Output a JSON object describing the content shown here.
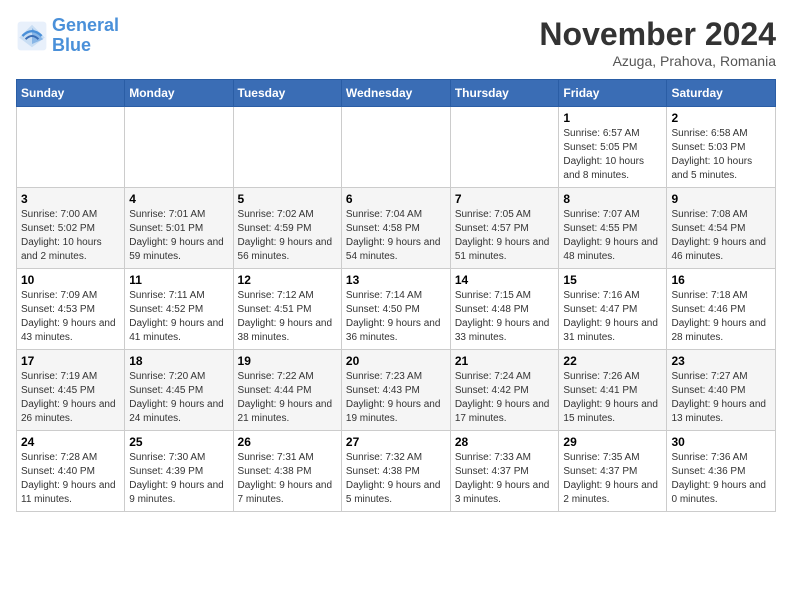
{
  "header": {
    "logo_line1": "General",
    "logo_line2": "Blue",
    "month": "November 2024",
    "location": "Azuga, Prahova, Romania"
  },
  "weekdays": [
    "Sunday",
    "Monday",
    "Tuesday",
    "Wednesday",
    "Thursday",
    "Friday",
    "Saturday"
  ],
  "weeks": [
    [
      {
        "day": "",
        "sunrise": "",
        "sunset": "",
        "daylight": ""
      },
      {
        "day": "",
        "sunrise": "",
        "sunset": "",
        "daylight": ""
      },
      {
        "day": "",
        "sunrise": "",
        "sunset": "",
        "daylight": ""
      },
      {
        "day": "",
        "sunrise": "",
        "sunset": "",
        "daylight": ""
      },
      {
        "day": "",
        "sunrise": "",
        "sunset": "",
        "daylight": ""
      },
      {
        "day": "1",
        "sunrise": "Sunrise: 6:57 AM",
        "sunset": "Sunset: 5:05 PM",
        "daylight": "Daylight: 10 hours and 8 minutes."
      },
      {
        "day": "2",
        "sunrise": "Sunrise: 6:58 AM",
        "sunset": "Sunset: 5:03 PM",
        "daylight": "Daylight: 10 hours and 5 minutes."
      }
    ],
    [
      {
        "day": "3",
        "sunrise": "Sunrise: 7:00 AM",
        "sunset": "Sunset: 5:02 PM",
        "daylight": "Daylight: 10 hours and 2 minutes."
      },
      {
        "day": "4",
        "sunrise": "Sunrise: 7:01 AM",
        "sunset": "Sunset: 5:01 PM",
        "daylight": "Daylight: 9 hours and 59 minutes."
      },
      {
        "day": "5",
        "sunrise": "Sunrise: 7:02 AM",
        "sunset": "Sunset: 4:59 PM",
        "daylight": "Daylight: 9 hours and 56 minutes."
      },
      {
        "day": "6",
        "sunrise": "Sunrise: 7:04 AM",
        "sunset": "Sunset: 4:58 PM",
        "daylight": "Daylight: 9 hours and 54 minutes."
      },
      {
        "day": "7",
        "sunrise": "Sunrise: 7:05 AM",
        "sunset": "Sunset: 4:57 PM",
        "daylight": "Daylight: 9 hours and 51 minutes."
      },
      {
        "day": "8",
        "sunrise": "Sunrise: 7:07 AM",
        "sunset": "Sunset: 4:55 PM",
        "daylight": "Daylight: 9 hours and 48 minutes."
      },
      {
        "day": "9",
        "sunrise": "Sunrise: 7:08 AM",
        "sunset": "Sunset: 4:54 PM",
        "daylight": "Daylight: 9 hours and 46 minutes."
      }
    ],
    [
      {
        "day": "10",
        "sunrise": "Sunrise: 7:09 AM",
        "sunset": "Sunset: 4:53 PM",
        "daylight": "Daylight: 9 hours and 43 minutes."
      },
      {
        "day": "11",
        "sunrise": "Sunrise: 7:11 AM",
        "sunset": "Sunset: 4:52 PM",
        "daylight": "Daylight: 9 hours and 41 minutes."
      },
      {
        "day": "12",
        "sunrise": "Sunrise: 7:12 AM",
        "sunset": "Sunset: 4:51 PM",
        "daylight": "Daylight: 9 hours and 38 minutes."
      },
      {
        "day": "13",
        "sunrise": "Sunrise: 7:14 AM",
        "sunset": "Sunset: 4:50 PM",
        "daylight": "Daylight: 9 hours and 36 minutes."
      },
      {
        "day": "14",
        "sunrise": "Sunrise: 7:15 AM",
        "sunset": "Sunset: 4:48 PM",
        "daylight": "Daylight: 9 hours and 33 minutes."
      },
      {
        "day": "15",
        "sunrise": "Sunrise: 7:16 AM",
        "sunset": "Sunset: 4:47 PM",
        "daylight": "Daylight: 9 hours and 31 minutes."
      },
      {
        "day": "16",
        "sunrise": "Sunrise: 7:18 AM",
        "sunset": "Sunset: 4:46 PM",
        "daylight": "Daylight: 9 hours and 28 minutes."
      }
    ],
    [
      {
        "day": "17",
        "sunrise": "Sunrise: 7:19 AM",
        "sunset": "Sunset: 4:45 PM",
        "daylight": "Daylight: 9 hours and 26 minutes."
      },
      {
        "day": "18",
        "sunrise": "Sunrise: 7:20 AM",
        "sunset": "Sunset: 4:45 PM",
        "daylight": "Daylight: 9 hours and 24 minutes."
      },
      {
        "day": "19",
        "sunrise": "Sunrise: 7:22 AM",
        "sunset": "Sunset: 4:44 PM",
        "daylight": "Daylight: 9 hours and 21 minutes."
      },
      {
        "day": "20",
        "sunrise": "Sunrise: 7:23 AM",
        "sunset": "Sunset: 4:43 PM",
        "daylight": "Daylight: 9 hours and 19 minutes."
      },
      {
        "day": "21",
        "sunrise": "Sunrise: 7:24 AM",
        "sunset": "Sunset: 4:42 PM",
        "daylight": "Daylight: 9 hours and 17 minutes."
      },
      {
        "day": "22",
        "sunrise": "Sunrise: 7:26 AM",
        "sunset": "Sunset: 4:41 PM",
        "daylight": "Daylight: 9 hours and 15 minutes."
      },
      {
        "day": "23",
        "sunrise": "Sunrise: 7:27 AM",
        "sunset": "Sunset: 4:40 PM",
        "daylight": "Daylight: 9 hours and 13 minutes."
      }
    ],
    [
      {
        "day": "24",
        "sunrise": "Sunrise: 7:28 AM",
        "sunset": "Sunset: 4:40 PM",
        "daylight": "Daylight: 9 hours and 11 minutes."
      },
      {
        "day": "25",
        "sunrise": "Sunrise: 7:30 AM",
        "sunset": "Sunset: 4:39 PM",
        "daylight": "Daylight: 9 hours and 9 minutes."
      },
      {
        "day": "26",
        "sunrise": "Sunrise: 7:31 AM",
        "sunset": "Sunset: 4:38 PM",
        "daylight": "Daylight: 9 hours and 7 minutes."
      },
      {
        "day": "27",
        "sunrise": "Sunrise: 7:32 AM",
        "sunset": "Sunset: 4:38 PM",
        "daylight": "Daylight: 9 hours and 5 minutes."
      },
      {
        "day": "28",
        "sunrise": "Sunrise: 7:33 AM",
        "sunset": "Sunset: 4:37 PM",
        "daylight": "Daylight: 9 hours and 3 minutes."
      },
      {
        "day": "29",
        "sunrise": "Sunrise: 7:35 AM",
        "sunset": "Sunset: 4:37 PM",
        "daylight": "Daylight: 9 hours and 2 minutes."
      },
      {
        "day": "30",
        "sunrise": "Sunrise: 7:36 AM",
        "sunset": "Sunset: 4:36 PM",
        "daylight": "Daylight: 9 hours and 0 minutes."
      }
    ]
  ]
}
